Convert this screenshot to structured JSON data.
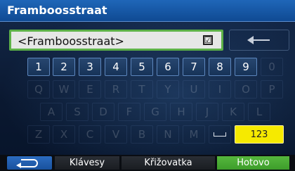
{
  "title": "Framboosstraat",
  "input": {
    "value": "<Framboosstraat>",
    "checkbox_glyph": "☑"
  },
  "keyboard": {
    "row_numbers": [
      "1",
      "2",
      "3",
      "4",
      "5",
      "6",
      "7",
      "8",
      "9",
      "0"
    ],
    "row_q": [
      "Q",
      "W",
      "E",
      "R",
      "T",
      "Y",
      "U",
      "I",
      "O",
      "P"
    ],
    "row_a": [
      "A",
      "S",
      "D",
      "F",
      "G",
      "H",
      "J",
      "K",
      "L"
    ],
    "row_z": [
      "Z",
      "X",
      "C",
      "V",
      "B",
      "N",
      "M"
    ],
    "mode_key": "123"
  },
  "bottom": {
    "keys_label": "Klávesy",
    "junction_label": "Křižovatka",
    "done_label": "Hotovo"
  },
  "colors": {
    "title_bar": "#1f66b8",
    "input_border": "#5db148",
    "yellow_key": "#f6ea00",
    "done_button": "#4aa735"
  }
}
